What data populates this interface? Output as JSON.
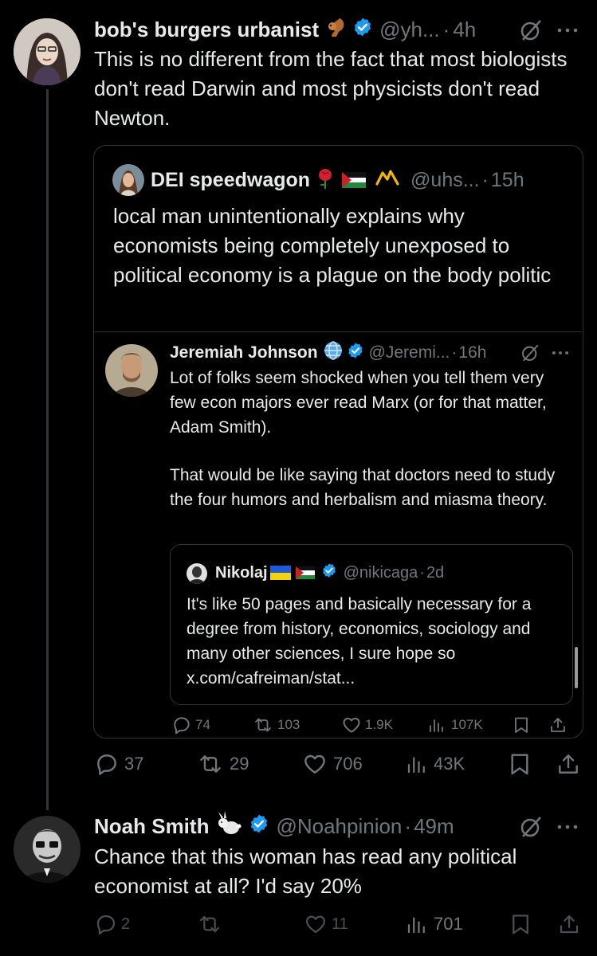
{
  "post1": {
    "display_name": "bob's burgers urbanist",
    "handle": "@yh...",
    "time": "4h",
    "text": "This is no different from the fact that most biologists don't read Darwin and most physicists don't read Newton.",
    "actions": {
      "replies": "37",
      "reposts": "29",
      "likes": "706",
      "views": "43K"
    }
  },
  "quote1": {
    "display_name": "DEI speedwagon",
    "handle": "@uhs...",
    "time": "15h",
    "text": "local man unintentionally explains why economists being completely unexposed to political economy is a plague on the body politic"
  },
  "quote2": {
    "display_name": "Jeremiah Johnson",
    "handle": "@Jeremi...",
    "time": "16h",
    "text_p1": "Lot of folks seem shocked when you tell them very few econ majors ever read Marx (or for that matter, Adam Smith).",
    "text_p2": "That would be like saying that doctors need to study the four humors and herbalism and miasma theory.",
    "actions": {
      "replies": "74",
      "reposts": "103",
      "likes": "1.9K",
      "views": "107K"
    }
  },
  "quote3": {
    "display_name": "Nikolaj",
    "handle": "@nikicaga",
    "time": "2d",
    "text": "It's like 50 pages and basically necessary for a degree from history, economics, sociology and many other sciences, I sure hope so x.com/cafreiman/stat..."
  },
  "post2": {
    "display_name": "Noah Smith",
    "handle": "@Noahpinion",
    "time": "49m",
    "text": "Chance that this woman has read any political economist at all? I'd say 20%",
    "actions": {
      "replies": "2",
      "reposts": "",
      "likes": "11",
      "views": "701"
    }
  },
  "separator": "·",
  "colors": {
    "background": "#000000",
    "text": "#e7e9ea",
    "muted": "#71767b",
    "verified": "#1d9bf0",
    "border": "#2f3336"
  },
  "icons": [
    "squirrel-emoji",
    "verified-badge",
    "grok-icon",
    "more-icon",
    "rose-emoji",
    "palestine-flag",
    "gold-crown-icon",
    "globe-emoji",
    "ukraine-flag",
    "rabbit-emoji",
    "reply-icon",
    "repost-icon",
    "like-icon",
    "views-icon",
    "bookmark-icon",
    "share-icon"
  ]
}
